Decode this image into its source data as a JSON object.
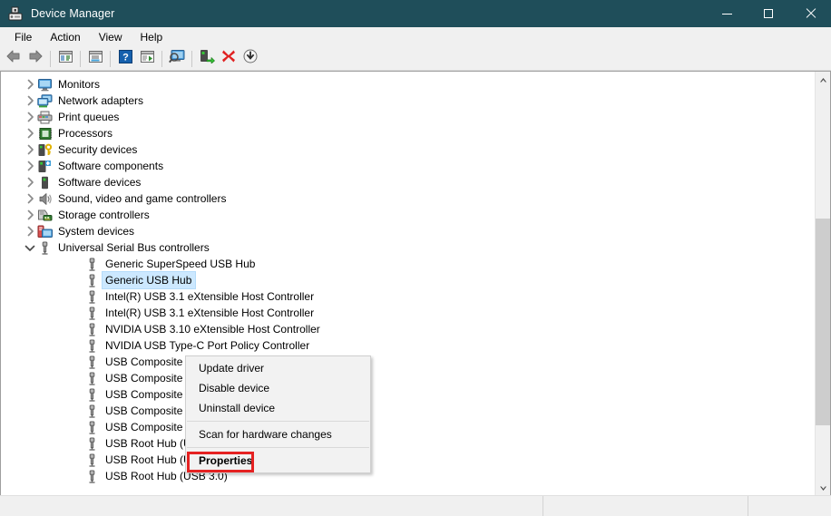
{
  "window": {
    "title": "Device Manager",
    "icon": "device-manager-icon",
    "titlebar_color": "#1f4e5a",
    "controls": {
      "minimize": "minimize-button",
      "maximize": "maximize-button",
      "close": "close-button"
    }
  },
  "menubar": {
    "items": [
      {
        "label": "File"
      },
      {
        "label": "Action"
      },
      {
        "label": "View"
      },
      {
        "label": "Help"
      }
    ]
  },
  "toolbar": {
    "buttons": [
      {
        "icon": "back-arrow-icon",
        "name": "back-button"
      },
      {
        "icon": "forward-arrow-icon",
        "name": "forward-button"
      },
      {
        "icon": "show-hide-console-tree-icon",
        "name": "show-hide-console-tree-button"
      },
      {
        "icon": "properties-window-icon",
        "name": "properties-button"
      },
      {
        "icon": "help-icon",
        "name": "help-button"
      },
      {
        "icon": "show-hide-action-pane-icon",
        "name": "show-hide-action-pane-button"
      },
      {
        "icon": "scan-for-hardware-changes-icon",
        "name": "scan-for-hardware-changes-button"
      },
      {
        "icon": "update-driver-icon",
        "name": "update-driver-button"
      },
      {
        "icon": "uninstall-device-icon",
        "name": "uninstall-device-button"
      },
      {
        "icon": "disable-device-icon",
        "name": "disable-device-button"
      }
    ]
  },
  "tree": {
    "nodes": [
      {
        "label": "Monitors",
        "icon": "monitor-icon",
        "level": 1,
        "expander": "collapsed",
        "selected": false
      },
      {
        "label": "Network adapters",
        "icon": "network-adapter-icon",
        "level": 1,
        "expander": "collapsed",
        "selected": false
      },
      {
        "label": "Print queues",
        "icon": "printer-icon",
        "level": 1,
        "expander": "collapsed",
        "selected": false
      },
      {
        "label": "Processors",
        "icon": "processor-icon",
        "level": 1,
        "expander": "collapsed",
        "selected": false
      },
      {
        "label": "Security devices",
        "icon": "security-device-icon",
        "level": 1,
        "expander": "collapsed",
        "selected": false
      },
      {
        "label": "Software components",
        "icon": "software-component-icon",
        "level": 1,
        "expander": "collapsed",
        "selected": false
      },
      {
        "label": "Software devices",
        "icon": "software-device-icon",
        "level": 1,
        "expander": "collapsed",
        "selected": false
      },
      {
        "label": "Sound, video and game controllers",
        "icon": "sound-controller-icon",
        "level": 1,
        "expander": "collapsed",
        "selected": false
      },
      {
        "label": "Storage controllers",
        "icon": "storage-controller-icon",
        "level": 1,
        "expander": "collapsed",
        "selected": false
      },
      {
        "label": "System devices",
        "icon": "system-device-icon",
        "level": 1,
        "expander": "collapsed",
        "selected": false
      },
      {
        "label": "Universal Serial Bus controllers",
        "icon": "usb-icon",
        "level": 1,
        "expander": "expanded",
        "selected": false
      },
      {
        "label": "Generic SuperSpeed USB Hub",
        "icon": "usb-icon",
        "level": 2,
        "expander": "none",
        "selected": false
      },
      {
        "label": "Generic USB Hub",
        "icon": "usb-icon",
        "level": 2,
        "expander": "none",
        "selected": true
      },
      {
        "label": "Intel(R) USB 3.1 eXtensible Host Controller",
        "icon": "usb-icon",
        "level": 2,
        "expander": "none",
        "selected": false
      },
      {
        "label": "Intel(R) USB 3.1 eXtensible Host Controller",
        "icon": "usb-icon",
        "level": 2,
        "expander": "none",
        "selected": false
      },
      {
        "label": "NVIDIA USB 3.10 eXtensible Host Controller",
        "icon": "usb-icon",
        "level": 2,
        "expander": "none",
        "selected": false
      },
      {
        "label": "NVIDIA USB Type-C Port Policy Controller",
        "icon": "usb-icon",
        "level": 2,
        "expander": "none",
        "selected": false
      },
      {
        "label": "USB Composite Device",
        "icon": "usb-icon",
        "level": 2,
        "expander": "none",
        "selected": false
      },
      {
        "label": "USB Composite Device",
        "icon": "usb-icon",
        "level": 2,
        "expander": "none",
        "selected": false
      },
      {
        "label": "USB Composite Device",
        "icon": "usb-icon",
        "level": 2,
        "expander": "none",
        "selected": false
      },
      {
        "label": "USB Composite Device",
        "icon": "usb-icon",
        "level": 2,
        "expander": "none",
        "selected": false
      },
      {
        "label": "USB Composite Device",
        "icon": "usb-icon",
        "level": 2,
        "expander": "none",
        "selected": false
      },
      {
        "label": "USB Root Hub (USB 3.0)",
        "icon": "usb-icon",
        "level": 2,
        "expander": "none",
        "selected": false
      },
      {
        "label": "USB Root Hub (USB 3.0)",
        "icon": "usb-icon",
        "level": 2,
        "expander": "none",
        "selected": false
      },
      {
        "label": "USB Root Hub (USB 3.0)",
        "icon": "usb-icon",
        "level": 2,
        "expander": "none",
        "selected": false
      }
    ],
    "selection_color": "#cce8ff"
  },
  "context_menu": {
    "items": [
      {
        "label": "Update driver",
        "bold": false,
        "separator_after": false
      },
      {
        "label": "Disable device",
        "bold": false,
        "separator_after": false
      },
      {
        "label": "Uninstall device",
        "bold": false,
        "separator_after": true
      },
      {
        "label": "Scan for hardware changes",
        "bold": false,
        "separator_after": true
      },
      {
        "label": "Properties",
        "bold": true,
        "separator_after": false
      }
    ]
  },
  "highlight": {
    "target": "Properties",
    "color": "#e52222"
  },
  "statusbar": {
    "pane1": "",
    "pane2": "",
    "pane3": ""
  },
  "scrollbar": {
    "up_arrow": "scroll-up-arrow-icon",
    "down_arrow": "scroll-down-arrow-icon",
    "thumb_color": "#cdcdcd"
  }
}
